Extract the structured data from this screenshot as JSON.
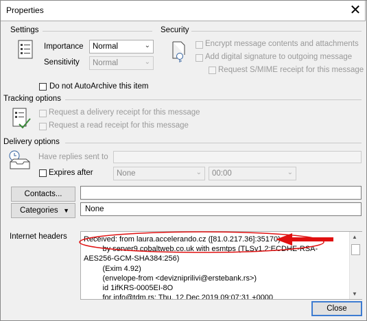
{
  "window": {
    "title": "Properties",
    "close_glyph": "✕"
  },
  "settings": {
    "label": "Settings",
    "importance_label": "Importance",
    "importance_value": "Normal",
    "sensitivity_label": "Sensitivity",
    "sensitivity_value": "Normal",
    "autoarchive_label": "Do not AutoArchive this item"
  },
  "security": {
    "label": "Security",
    "encrypt_label": "Encrypt message contents and attachments",
    "signature_label": "Add digital signature to outgoing message",
    "smime_label": "Request S/MIME receipt for this message"
  },
  "tracking": {
    "label": "Tracking options",
    "delivery_receipt_label": "Request a delivery receipt for this message",
    "read_receipt_label": "Request a read receipt for this message"
  },
  "delivery": {
    "label": "Delivery options",
    "replies_label": "Have replies sent to",
    "expires_label": "Expires after",
    "expires_date": "None",
    "expires_time": "00:00"
  },
  "contacts_button": "Contacts...",
  "categories_button": "Categories",
  "categories_value": "None",
  "internet_headers": {
    "label": "Internet headers",
    "text": "Received: from laura.accelerando.cz ([81.0.217.36]:35170)\n         by server9.cobaltweb.co.uk with esmtps (TLSv1.2:ECDHE-RSA-\nAES256-GCM-SHA384:256)\n         (Exim 4.92)\n         (envelope-from <devizniprilivi@erstebank.rs>)\n         id 1ifKRS-0005EI-8O\n         for info@tdm.rs; Thu, 12 Dec 2019 09:07:31 +0000"
  },
  "close_button": "Close",
  "annotation_color": "#e01010"
}
